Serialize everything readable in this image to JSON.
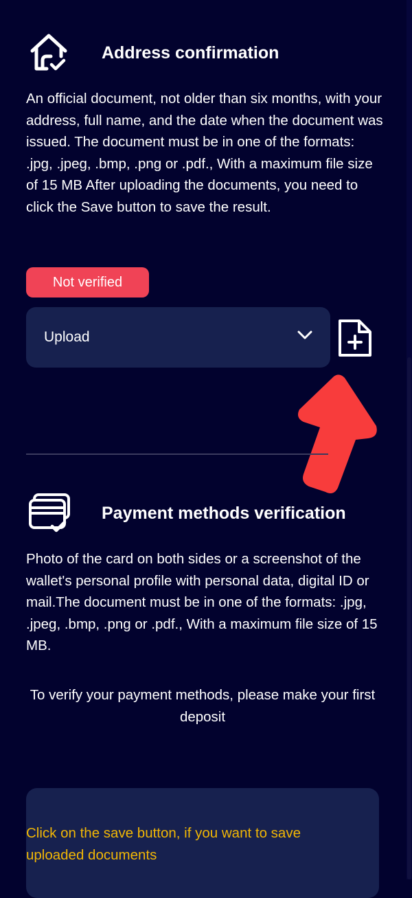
{
  "address_section": {
    "icon": "home-check-icon",
    "title": "Address confirmation",
    "description": "An official document, not older than six months, with your address, full name, and the date when the document was issued. The document must be in one of the formats: .jpg, .jpeg, .bmp, .png or .pdf., With a maximum file size of 15 MB After uploading the documents, you need to click the Save button to save the result.",
    "status_badge": "Not verified",
    "upload_select": {
      "value": "Upload",
      "icon": "chevron-down-icon"
    },
    "add_file_button": {
      "icon": "file-plus-icon"
    },
    "annotation_arrow": {
      "icon": "arrow-up-icon",
      "color": "#f83c3c"
    }
  },
  "payment_section": {
    "icon": "cards-check-icon",
    "title": "Payment methods verification",
    "description": "Photo of the card on both sides or a screenshot of the wallet's personal profile with personal data, digital ID or mail.The document must be in one of the formats: .jpg, .jpeg, .bmp, .png or .pdf., With a maximum file size of 15 MB.",
    "deposit_note": "To verify your payment methods, please make your first deposit"
  },
  "save_panel": {
    "note": "Click on the save button, if you want to save uploaded documents"
  },
  "colors": {
    "background": "#02022e",
    "panel": "#17214f",
    "badge_red": "#f04356",
    "warning_yellow": "#f2b705",
    "arrow_red": "#f83c3c"
  }
}
